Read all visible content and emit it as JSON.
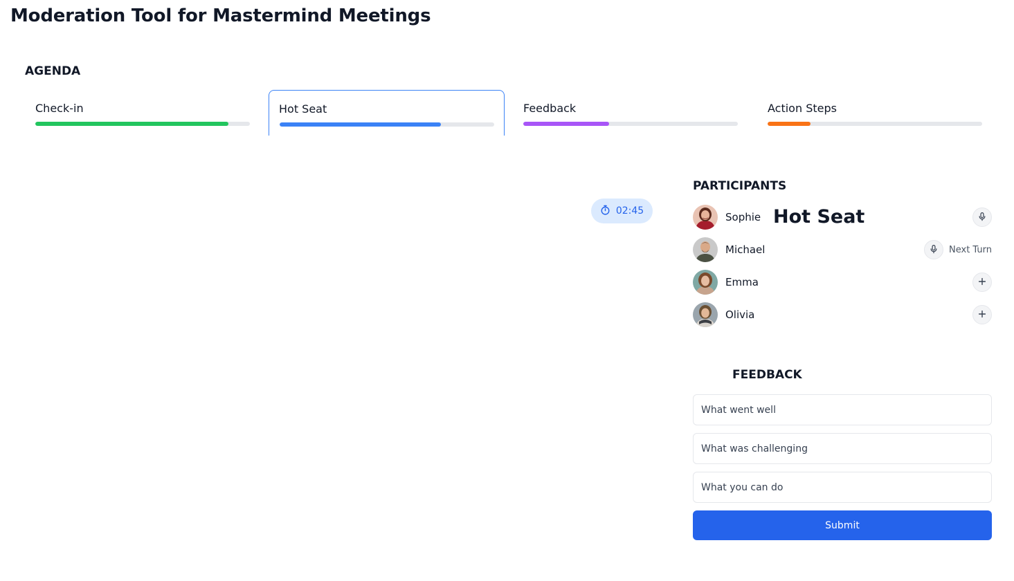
{
  "app": {
    "title": "Moderation Tool for Mastermind Meetings"
  },
  "agenda": {
    "heading": "AGENDA",
    "items": [
      {
        "label": "Check-in",
        "progress": 0.9,
        "color": "#22c55e",
        "active": false
      },
      {
        "label": "Hot Seat",
        "progress": 0.75,
        "color": "#3b82f6",
        "active": true
      },
      {
        "label": "Feedback",
        "progress": 0.4,
        "color": "#a855f7",
        "active": false
      },
      {
        "label": "Action Steps",
        "progress": 0.2,
        "color": "#f97316",
        "active": false
      }
    ]
  },
  "timer": {
    "value": "02:45",
    "icon": "stopwatch-icon"
  },
  "participants": {
    "heading": "PARTICIPANTS",
    "hot_seat_label": "Hot Seat",
    "next_turn_label": "Next Turn",
    "list": [
      {
        "name": "Sophie",
        "action_icon": "microphone-icon"
      },
      {
        "name": "Michael",
        "action_icon": "microphone-icon"
      },
      {
        "name": "Emma",
        "action_icon": "plus-icon"
      },
      {
        "name": "Olivia",
        "action_icon": "plus-icon"
      }
    ]
  },
  "feedback": {
    "heading": "FEEDBACK",
    "fields": [
      {
        "placeholder": "What went well"
      },
      {
        "placeholder": "What was challenging"
      },
      {
        "placeholder": "What you can do"
      }
    ],
    "submit_label": "Submit"
  },
  "colors": {
    "accent": "#2563eb",
    "timer_bg": "#dbeafe"
  }
}
